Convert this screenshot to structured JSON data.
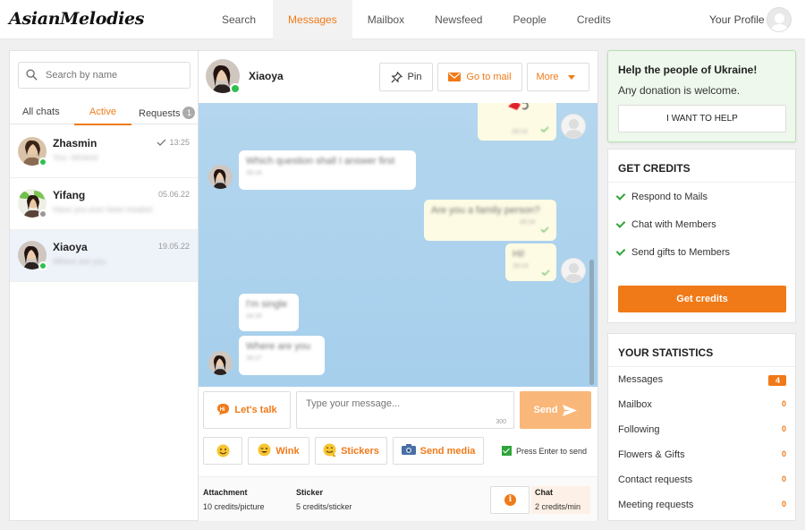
{
  "brand": {
    "name": "AsianMelodies"
  },
  "nav": {
    "items": [
      "Search",
      "Messages",
      "Mailbox",
      "Newsfeed",
      "People",
      "Credits"
    ],
    "active": "Messages",
    "profile_label": "Your Profile"
  },
  "left": {
    "search_placeholder": "Search by name",
    "tabs": {
      "all": "All chats",
      "active": "Active",
      "requests": "Requests",
      "requests_count": "1"
    },
    "chats": [
      {
        "name": "Zhasmin",
        "time": "13:25",
        "preview": "You: Winked",
        "status": "online",
        "status_color": "#2fbf4f"
      },
      {
        "name": "Yifang",
        "time": "05.06.22",
        "preview": "Have you ever been treated",
        "status": "offline",
        "status_color": "#999999"
      },
      {
        "name": "Xiaoya",
        "time": "19.05.22",
        "preview": "Where are you",
        "status": "online",
        "status_color": "#2fbf4f"
      }
    ]
  },
  "conversation": {
    "contact_name": "Xiaoya",
    "buttons": {
      "pin": "Pin",
      "mail": "Go to mail",
      "more": "More"
    },
    "messages": [
      {
        "from": "me",
        "text": "",
        "time": "16:14"
      },
      {
        "from": "them",
        "text": "Which question shall I answer first",
        "time": "16:14"
      },
      {
        "from": "me",
        "text": "Are you a family person?",
        "time": "16:14"
      },
      {
        "from": "me",
        "text": "Hi!",
        "time": "16:14"
      },
      {
        "from": "them",
        "text": "I'm single",
        "time": "16:15"
      },
      {
        "from": "them",
        "text": "Where are you",
        "time": "16:17"
      }
    ]
  },
  "compose": {
    "lets_talk": "Let's talk",
    "placeholder": "Type your message...",
    "char_limit": "300",
    "send": "Send",
    "wink": "Wink",
    "stickers": "Stickers",
    "send_media": "Send media",
    "press_enter": "Press Enter to send"
  },
  "costs": {
    "attachment_label": "Attachment",
    "attachment_value": "10 credits/picture",
    "sticker_label": "Sticker",
    "sticker_value": "5 credits/sticker",
    "chat_label": "Chat",
    "chat_value": "2 credits/min"
  },
  "ukraine": {
    "title": "Help the people of Ukraine!",
    "subtitle": "Any donation is welcome.",
    "button": "I WANT TO HELP"
  },
  "credits": {
    "title": "GET CREDITS",
    "features": [
      "Respond to Mails",
      "Chat with Members",
      "Send gifts to Members"
    ],
    "button": "Get credits"
  },
  "stats": {
    "title": "YOUR STATISTICS",
    "rows": [
      {
        "label": "Messages",
        "value": "4"
      },
      {
        "label": "Mailbox",
        "value": "0"
      },
      {
        "label": "Following",
        "value": "0"
      },
      {
        "label": "Flowers & Gifts",
        "value": "0"
      },
      {
        "label": "Contact requests",
        "value": "0"
      },
      {
        "label": "Meeting requests",
        "value": "0"
      }
    ]
  },
  "colors": {
    "accent": "#f07a18",
    "online": "#2fbf4f",
    "chat_bg": "#b4d6ee"
  }
}
